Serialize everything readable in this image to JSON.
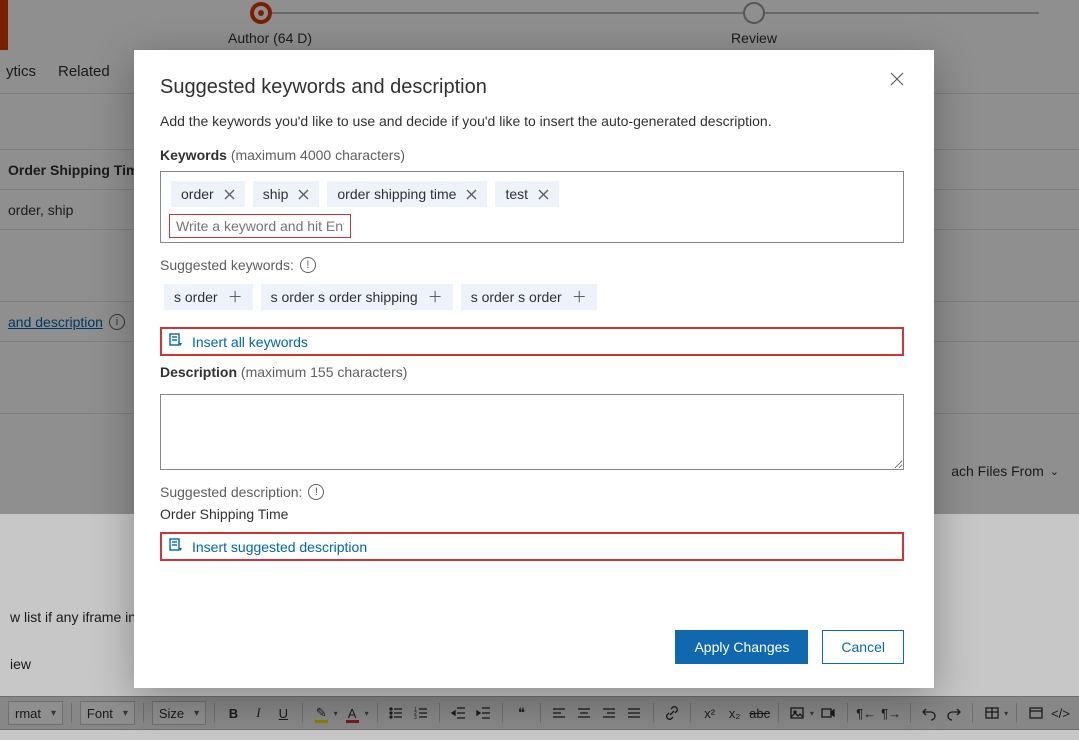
{
  "stepper": {
    "author_label": "Author  (64 D)",
    "review_label": "Review"
  },
  "bg": {
    "tab_analytics": "ytics",
    "tab_related": "Related",
    "row_title": "Order Shipping Time",
    "row_keywords": "order, ship",
    "link_suggest": " and description",
    "attach_label": "ach Files From",
    "bottom_text": "w list if any iframe in t",
    "review_text": "iew"
  },
  "toolbar": {
    "format": "rmat",
    "font": "Font",
    "size": "Size"
  },
  "modal": {
    "title": "Suggested keywords and description",
    "subhead": "Add the keywords you'd like to use and decide if you'd like to insert the auto-generated description.",
    "keywords_label": "Keywords",
    "keywords_hint": "(maximum 4000 characters)",
    "chips": [
      "order",
      "ship",
      "order shipping time",
      "test"
    ],
    "kw_placeholder": "Write a keyword and hit Enter",
    "suggested_kw_label": "Suggested keywords:",
    "suggested_chips": [
      "s order",
      "s order s order shipping",
      "s order s order"
    ],
    "insert_all": "Insert all keywords",
    "description_label": "Description",
    "description_hint": "(maximum 155 characters)",
    "suggested_desc_label": "Suggested description:",
    "suggested_desc_value": "Order Shipping Time",
    "insert_desc": "Insert suggested description",
    "apply": "Apply Changes",
    "cancel": "Cancel"
  }
}
